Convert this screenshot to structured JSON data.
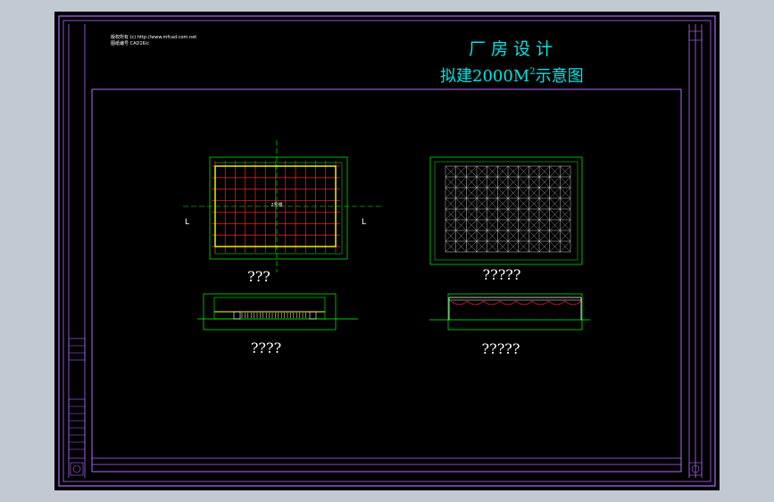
{
  "title": {
    "line1": "厂 房 设 计",
    "line2": "拟建2000M",
    "line2_sup": "2",
    "line2_tail": "示意图"
  },
  "note": {
    "line1": "版权所有 (c) http://www.mfcad.com.net",
    "line2": "图纸编号 CAD16/c"
  },
  "views": {
    "plan_label": "???",
    "roof_label": "?????",
    "front_label": "????",
    "side_label": "?????",
    "plan_center_text": "2号楼",
    "section_marker": "L"
  },
  "colors": {
    "frame": "#b26bff",
    "grid_red": "#ff2020",
    "outline_green": "#00ff00",
    "wall_yellow": "#ffff00",
    "roof_white": "#ffffff",
    "title_cyan": "#00e5e5"
  }
}
